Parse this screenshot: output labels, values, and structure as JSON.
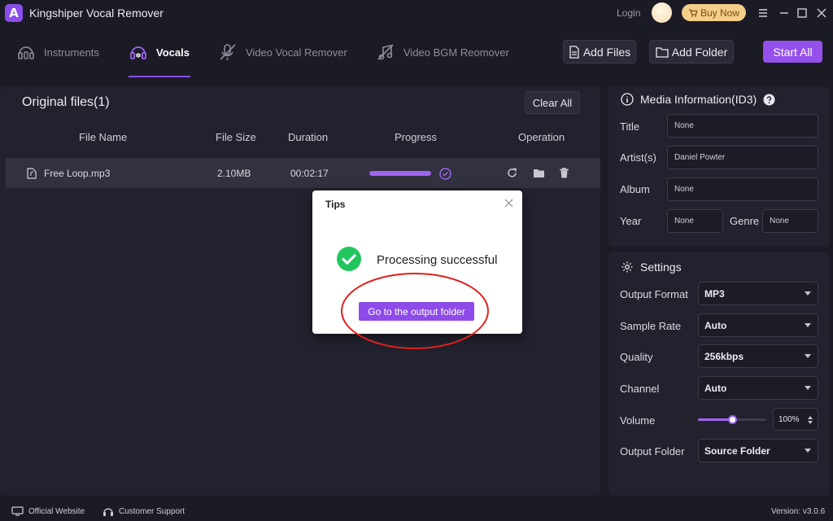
{
  "app": {
    "title": "Kingshiper Vocal Remover",
    "logo_letter": "A",
    "login_label": "Login",
    "buy_now_label": "Buy Now"
  },
  "nav": {
    "tabs": [
      {
        "label": "Instruments",
        "icon": "instruments-icon"
      },
      {
        "label": "Vocals",
        "icon": "vocals-icon",
        "active": true
      },
      {
        "label": "Video Vocal Remover",
        "icon": "video-vocal-icon"
      },
      {
        "label": "Video BGM Reomover",
        "icon": "video-bgm-icon"
      }
    ],
    "add_files_label": "Add Files",
    "add_folder_label": "Add Folder",
    "start_all_label": "Start All"
  },
  "files": {
    "title": "Original files(1)",
    "clear_all_label": "Clear All",
    "columns": [
      "File Name",
      "File Size",
      "Duration",
      "Progress",
      "Operation"
    ],
    "rows": [
      {
        "name": "Free Loop.mp3",
        "size": "2.10MB",
        "duration": "00:02:17",
        "progress": 1.0
      }
    ]
  },
  "media_info": {
    "title": "Media Information(ID3)",
    "title_label": "Title",
    "title_value": "None",
    "artist_label": "Artist(s)",
    "artist_value": "Daniel Powter",
    "album_label": "Album",
    "album_value": "None",
    "year_label": "Year",
    "year_value": "None",
    "genre_label": "Genre",
    "genre_value": "None"
  },
  "settings": {
    "title": "Settings",
    "output_format_label": "Output Format",
    "output_format_value": "MP3",
    "sample_rate_label": "Sample Rate",
    "sample_rate_value": "Auto",
    "quality_label": "Quality",
    "quality_value": "256kbps",
    "channel_label": "Channel",
    "channel_value": "Auto",
    "volume_label": "Volume",
    "volume_value": "100%",
    "volume_level": 0.5,
    "output_folder_label": "Output Folder",
    "output_folder_value": "Source Folder"
  },
  "footer": {
    "official_website_label": "Official Website",
    "customer_support_label": "Customer Support",
    "version": "Version: v3.0.6"
  },
  "dialog": {
    "title": "Tips",
    "message": "Processing successful",
    "button_label": "Go to the output folder"
  },
  "colors": {
    "accent": "#9550ec",
    "success": "#22c55e",
    "annotation": "#e0201b"
  }
}
